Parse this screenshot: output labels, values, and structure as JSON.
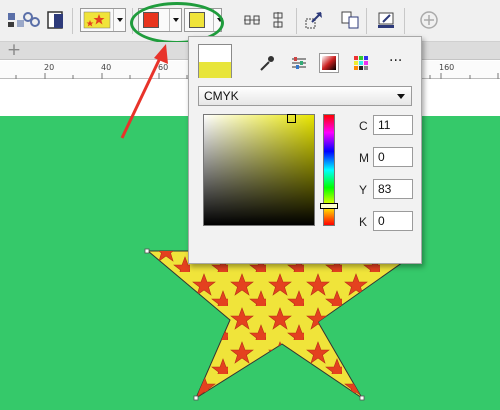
{
  "colors": {
    "fill_swatch": "#e8351e",
    "outline_swatch": "#f0e43a",
    "canvas": "#35c96a",
    "star_fill": "#f0e43a",
    "pattern_star": "#e4411f"
  },
  "toolbar": {
    "icons": [
      "align-icon",
      "layers-icon",
      "shadow-icon",
      "pattern-fill-icon",
      "fill-color-icon",
      "outline-color-icon",
      "distribute-h-icon",
      "distribute-v-icon",
      "transform-icon",
      "copy-props-icon",
      "edit-fill-icon",
      "add-icon"
    ]
  },
  "ruler": {
    "ticks": [
      "20",
      "40",
      "60",
      "160"
    ]
  },
  "color_popup": {
    "color_model": "CMYK",
    "channels": [
      {
        "label": "C",
        "value": "11"
      },
      {
        "label": "M",
        "value": "0"
      },
      {
        "label": "Y",
        "value": "83"
      },
      {
        "label": "K",
        "value": "0"
      }
    ],
    "more_label": "...",
    "preview_new_color": "#e8e53a"
  }
}
